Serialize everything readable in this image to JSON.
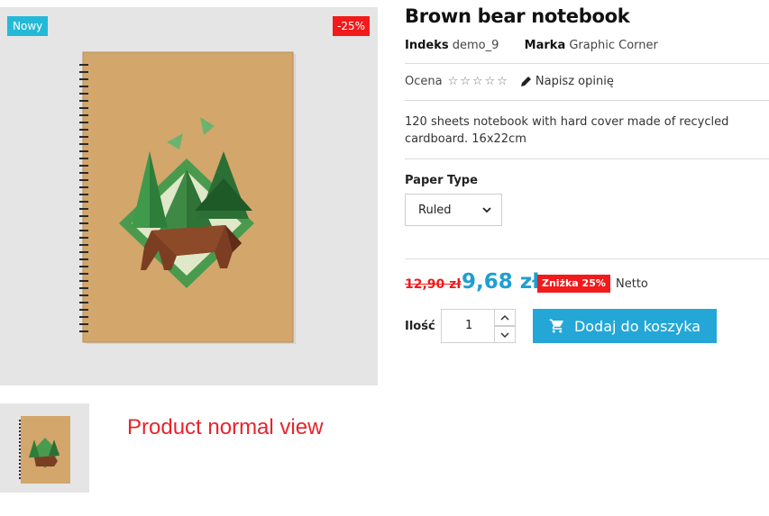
{
  "badges": {
    "new": "Nowy",
    "discount": "-25%"
  },
  "caption": "Product normal view",
  "product": {
    "title": "Brown bear notebook",
    "reference_label": "Indeks",
    "reference_value": "demo_9",
    "brand_label": "Marka",
    "brand_value": "Graphic Corner",
    "rating_label": "Ocena",
    "review_link": "Napisz opinię",
    "description": "120 sheets notebook with hard cover made of recycled cardboard. 16x22cm",
    "paper_type_label": "Paper Type",
    "paper_type_selected": "Ruled"
  },
  "pricing": {
    "old_price": "12,90 zł",
    "price": "9,68 zł",
    "discount_badge": "Zniżka 25%",
    "tax_label": "Netto"
  },
  "cart": {
    "quantity_label": "Ilość",
    "quantity_value": "1",
    "add_to_cart": "Dodaj do koszyka"
  },
  "icons": {
    "stars": [
      "star-outline-icon",
      "star-outline-icon",
      "star-outline-icon",
      "star-outline-icon",
      "star-outline-icon"
    ],
    "pencil": "pencil-icon",
    "cart": "shopping-cart-icon",
    "chevron": "chevron-down-icon"
  },
  "colors": {
    "accent": "#24a7d6",
    "price": "#1e9fd0",
    "sale": "#f21a1a",
    "new_badge": "#24b9d7"
  }
}
